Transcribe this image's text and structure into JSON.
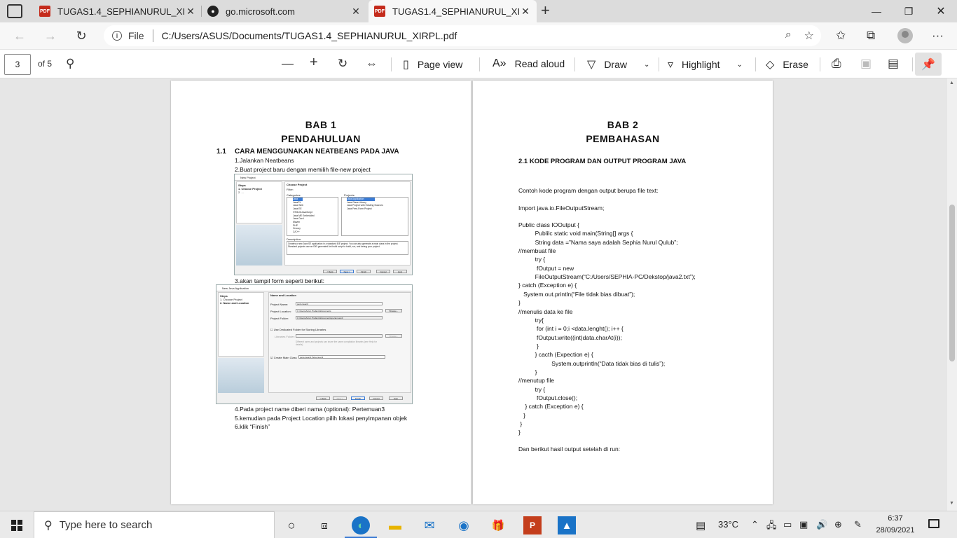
{
  "tabs": [
    {
      "title": "TUGAS1.4_SEPHIANURUL_XIRPL.",
      "favicon": "PDF"
    },
    {
      "title": "go.microsoft.com",
      "favicon": "ms"
    },
    {
      "title": "TUGAS1.4_SEPHIANURUL_XIRPL.",
      "favicon": "PDF"
    }
  ],
  "address": {
    "file_label": "File",
    "url": "C:/Users/ASUS/Documents/TUGAS1.4_SEPHIANURUL_XIRPL.pdf"
  },
  "pdf_toolbar": {
    "page_current": "3",
    "page_total": "of 5",
    "page_view": "Page view",
    "read_aloud": "Read aloud",
    "draw": "Draw",
    "highlight": "Highlight",
    "erase": "Erase"
  },
  "page1": {
    "chapter": "BAB 1",
    "chapter_title": "PENDAHULUAN",
    "section_num": "1.1",
    "section_title": "CARA MENGGUNAKAN NEATBEANS PADA JAVA",
    "lines_top": [
      "1.Jalankan Neatbeans",
      "2.Buat project baru dengan memilih file-new project"
    ],
    "line_mid": "3.akan tampil form seperti berikut:",
    "lines_bottom": [
      "4.Pada project name diberi nama (optional): Pertemuan3",
      "5.kemudian pada Project Location pilih lokasi penyimpanan objek",
      "6.klik “Finish”"
    ],
    "shot1": {
      "title": "New Project",
      "steps_head": "Steps",
      "step1": "1.    Choose Project",
      "step2": "2.    ...",
      "panel_title": "Choose Project",
      "filter": "Filter:",
      "categories_label": "Categories:",
      "projects_label": "Projects:",
      "categories": [
        "Java",
        "JavaFX",
        "Java Web",
        "Java EE",
        "HTML5/JavaScript",
        "Java ME Embedded",
        "Java Card",
        "Maven",
        "PHP",
        "Groovy",
        "C/C++"
      ],
      "projects": [
        "Java Application",
        "Java Class Library",
        "Java Project with Existing Sources",
        "Java Free-Form Project"
      ],
      "desc_label": "Description:",
      "desc": "Creates a new Java SE application in a standard IDE project. You can also generate a main class in the project. Standard projects use an IDE-generated Ant build script to build, run, and debug your project.",
      "buttons": [
        "< Back",
        "Next >",
        "Finish",
        "Cancel",
        "Help"
      ]
    },
    "shot2": {
      "title": "New Java Application",
      "steps_head": "Steps",
      "step1": "1.    Choose Project",
      "step2": "2.    Name and Location",
      "panel_title": "Name and Location",
      "project_name_label": "Project Name:",
      "project_name": "pertemuan3",
      "location_label": "Project Location:",
      "location": "C:\\Users\\Anton Prafanto\\Documents",
      "folder_label": "Project Folder:",
      "folder": "C:\\Users\\Anton Prafanto\\Documents\\pertemuan3",
      "browse": "Browse...",
      "dedicated": "Use Dedicated Folder for Storing Libraries",
      "libraries_label": "Libraries Folder:",
      "libraries_note": "Different users and projects can share the same compilation libraries (see Help for details).",
      "main_class_label": "Create Main Class",
      "main_class": "pertemuan3.Pertemuan3",
      "buttons": [
        "< Back",
        "Next >",
        "Finish",
        "Cancel",
        "Help"
      ]
    }
  },
  "page2": {
    "chapter": "BAB 2",
    "chapter_title": "PEMBAHASAN",
    "section_title": "2.1 KODE PROGRAM DAN OUTPUT PROGRAM JAVA",
    "intro": "Contoh kode program dengan output berupa file text:",
    "import_line": "Import java.io.FileOutputStream;",
    "code": [
      "Public class IOOutput {",
      "          Publilc static void main(String[] args {",
      "          String data =”Nama saya adalah Sephia Nurul Qulub”;",
      "//membuat file",
      "          try {",
      "           fOutput = new",
      "          FileOutputStream(“C:/Users/SEPHIA-PC/Dekstop/java2.txt”);",
      "} catch (Exception e) {",
      "   System.out.println(“File tidak bias dibuat”);",
      "}",
      "//menulis data ke file",
      "          try{",
      "           for (int i = 0;i <data.lenght(); i++ {",
      "           fOutput.write((int)data.charAt(i));",
      "           }",
      "          } cacth (Expection e) {",
      "                    System.outprintln(“Data tidak bias di tulis”);",
      "          }",
      "//menutup file",
      "          try {",
      "           fOutput.close();",
      "    } catch (Exception e) {",
      "   }",
      " }",
      "}"
    ],
    "outro": "Dan berikut hasil output setelah di run:"
  },
  "taskbar": {
    "search_placeholder": "Type here to search",
    "temperature": "33°C",
    "time": "6:37",
    "date": "28/09/2021"
  }
}
